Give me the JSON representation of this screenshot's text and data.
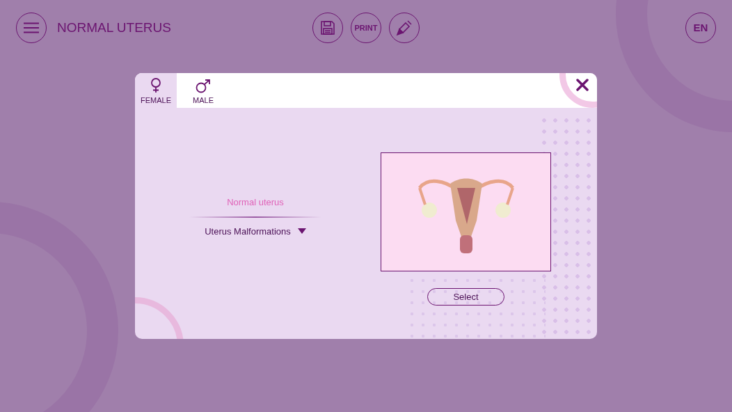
{
  "header": {
    "title": "NORMAL UTERUS",
    "toolbar": [
      {
        "kind": "save"
      },
      {
        "kind": "print",
        "label": "PRINT"
      },
      {
        "kind": "edit"
      }
    ],
    "language": "EN"
  },
  "dialog": {
    "tabs": [
      {
        "kind": "female",
        "label": "FEMALE",
        "selected": true
      },
      {
        "kind": "male",
        "label": "MALE",
        "selected": false
      }
    ],
    "options": [
      {
        "kind": "item",
        "label": "Normal uterus",
        "selected": true
      },
      {
        "kind": "dropdown",
        "label": "Uterus Malformations",
        "selected": false
      }
    ],
    "select_button": "Select"
  }
}
